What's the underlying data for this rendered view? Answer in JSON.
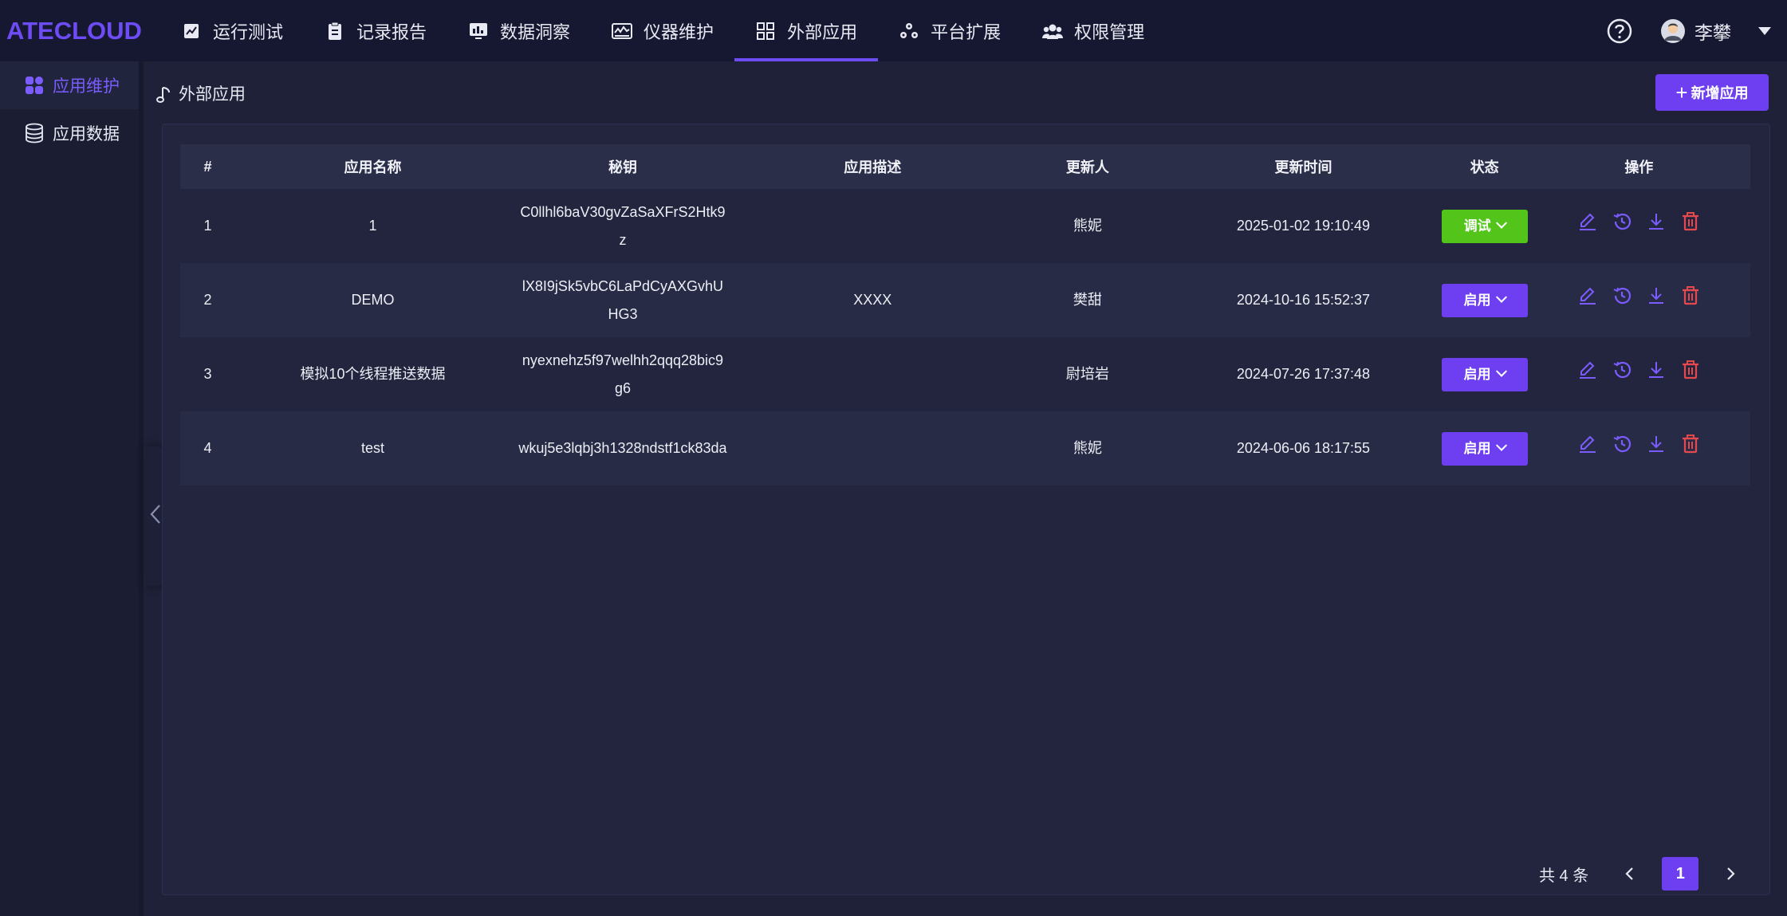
{
  "app": {
    "logo": "ATECLOUD"
  },
  "nav": [
    {
      "label": "运行测试",
      "icon": "line-chart-icon"
    },
    {
      "label": "记录报告",
      "icon": "clipboard-icon"
    },
    {
      "label": "数据洞察",
      "icon": "monitor-chart-icon"
    },
    {
      "label": "仪器维护",
      "icon": "instrument-icon"
    },
    {
      "label": "外部应用",
      "icon": "grid-icon",
      "active": true
    },
    {
      "label": "平台扩展",
      "icon": "cluster-icon"
    },
    {
      "label": "权限管理",
      "icon": "users-icon"
    }
  ],
  "user": {
    "name": "李攀"
  },
  "sidebar": {
    "items": [
      {
        "label": "应用维护",
        "icon": "apps-icon",
        "active": true
      },
      {
        "label": "应用数据",
        "icon": "database-icon"
      }
    ]
  },
  "page": {
    "title": "外部应用",
    "add_button": "新增应用"
  },
  "table": {
    "headers": [
      "#",
      "应用名称",
      "秘钥",
      "应用描述",
      "更新人",
      "更新时间",
      "状态",
      "操作"
    ],
    "rows": [
      {
        "index": "1",
        "name": "1",
        "secret": "C0llhl6baV30gvZaSaXFrS2Htk9z",
        "desc": "",
        "updater": "熊妮",
        "time": "2025-01-02 19:10:49",
        "status": "调试",
        "status_color": "#52c41a"
      },
      {
        "index": "2",
        "name": "DEMO",
        "secret": "lX8I9jSk5vbC6LaPdCyAXGvhUHG3",
        "desc": "XXXX",
        "updater": "樊甜",
        "time": "2024-10-16 15:52:37",
        "status": "启用",
        "status_color": "#6d3ff0"
      },
      {
        "index": "3",
        "name": "模拟10个线程推送数据",
        "secret": "nyexnehz5f97welhh2qqq28bic9g6",
        "desc": "",
        "updater": "尉培岩",
        "time": "2024-07-26 17:37:48",
        "status": "启用",
        "status_color": "#6d3ff0"
      },
      {
        "index": "4",
        "name": "test",
        "secret": "wkuj5e3lqbj3h1328ndstf1ck83da",
        "desc": "",
        "updater": "熊妮",
        "time": "2024-06-06 18:17:55",
        "status": "启用",
        "status_color": "#6d3ff0"
      }
    ]
  },
  "pagination": {
    "total_text": "共 4 条",
    "current_page": "1"
  },
  "colors": {
    "accent": "#6d3ff0",
    "logo": "#6d4cf5",
    "danger": "#e5484d",
    "success": "#52c41a"
  }
}
